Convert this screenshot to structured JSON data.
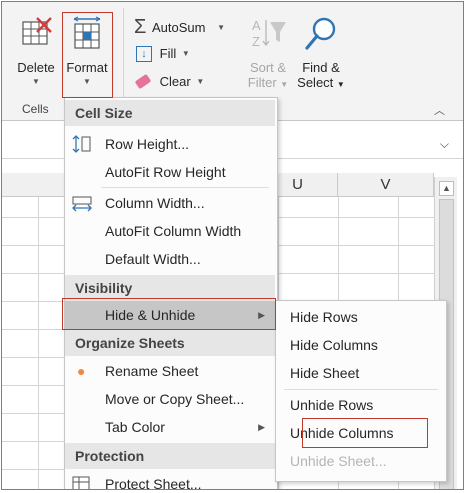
{
  "ribbon": {
    "delete_label": "Delete",
    "format_label": "Format",
    "autosum_label": "AutoSum",
    "fill_label": "Fill",
    "clear_label": "Clear",
    "sort_filter_line1": "Sort &",
    "sort_filter_line2": "Filter",
    "find_select_line1": "Find &",
    "find_select_line2": "Select",
    "cells_group_label": "Cells"
  },
  "sheet": {
    "columns": [
      "U",
      "V"
    ]
  },
  "format_menu": {
    "sections": {
      "cell_size": "Cell Size",
      "visibility": "Visibility",
      "organize_sheets": "Organize Sheets",
      "protection": "Protection"
    },
    "items": {
      "row_height": "Row Height...",
      "autofit_row_height": "AutoFit Row Height",
      "column_width": "Column Width...",
      "autofit_column_width": "AutoFit Column Width",
      "default_width": "Default Width...",
      "hide_unhide": "Hide & Unhide",
      "rename_sheet": "Rename Sheet",
      "move_copy_sheet": "Move or Copy Sheet...",
      "tab_color": "Tab Color",
      "protect_sheet": "Protect Sheet..."
    }
  },
  "hide_unhide_submenu": {
    "hide_rows": "Hide Rows",
    "hide_columns": "Hide Columns",
    "hide_sheet": "Hide Sheet",
    "unhide_rows": "Unhide Rows",
    "unhide_columns": "Unhide Columns",
    "unhide_sheet": "Unhide Sheet..."
  },
  "colors": {
    "highlight_border": "#c0392b",
    "accent_blue": "#2e75b6",
    "rename_dot": "#f0883d"
  }
}
